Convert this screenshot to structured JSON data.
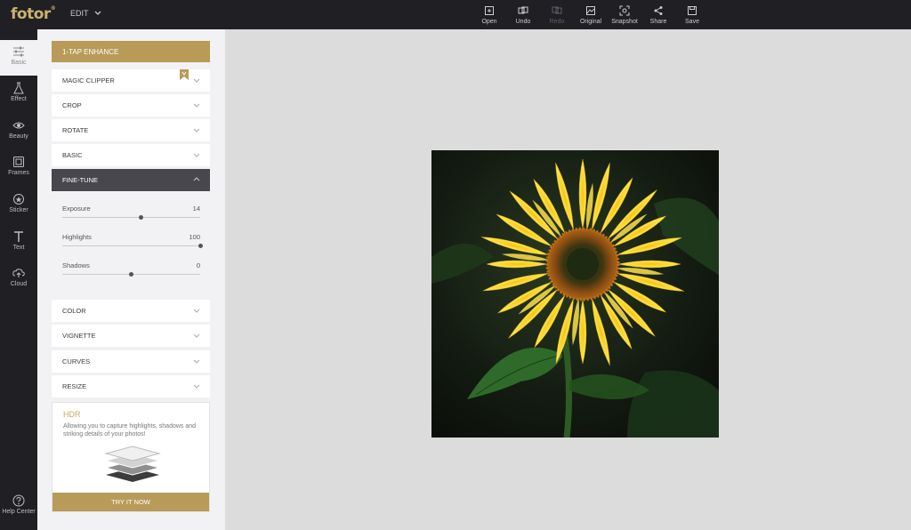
{
  "app": {
    "logo": "fotor",
    "logo_mark": "®",
    "edit_menu": "EDIT"
  },
  "toolbar": [
    {
      "label": "Open",
      "icon": "open-icon",
      "enabled": true
    },
    {
      "label": "Undo",
      "icon": "undo-icon",
      "enabled": true
    },
    {
      "label": "Redo",
      "icon": "redo-icon",
      "enabled": false
    },
    {
      "label": "Original",
      "icon": "original-icon",
      "enabled": true
    },
    {
      "label": "Snapshot",
      "icon": "snapshot-icon",
      "enabled": true
    },
    {
      "label": "Share",
      "icon": "share-icon",
      "enabled": true
    },
    {
      "label": "Save",
      "icon": "save-icon",
      "enabled": true
    }
  ],
  "rail": [
    {
      "label": "Basic",
      "icon": "sliders-icon",
      "active": true
    },
    {
      "label": "Effect",
      "icon": "flask-icon"
    },
    {
      "label": "Beauty",
      "icon": "eye-icon"
    },
    {
      "label": "Frames",
      "icon": "frame-icon"
    },
    {
      "label": "Sticker",
      "icon": "sticker-icon"
    },
    {
      "label": "Text",
      "icon": "text-icon"
    },
    {
      "label": "Cloud",
      "icon": "cloud-icon"
    }
  ],
  "help": {
    "label": "Help Center",
    "icon": "help-icon"
  },
  "panel": {
    "enhance_label": "1-TAP ENHANCE",
    "sections": [
      "MAGIC CLIPPER",
      "CROP",
      "ROTATE",
      "BASIC",
      "FINE-TUNE",
      "COLOR",
      "VIGNETTE",
      "CURVES",
      "RESIZE"
    ],
    "open_section": "FINE-TUNE",
    "finetune": [
      {
        "label": "Exposure",
        "value": "14",
        "fraction": 0.57
      },
      {
        "label": "Highlights",
        "value": "100",
        "fraction": 1.0
      },
      {
        "label": "Shadows",
        "value": "0",
        "fraction": 0.5
      }
    ],
    "hdr": {
      "title": "HDR",
      "description": "Allowing you to capture highlights, shadows and striking details of your photos!",
      "button": "TRY IT NOW"
    }
  },
  "colors": {
    "accent": "#b89b58",
    "dark": "#1f1f24",
    "open_section": "#48474d"
  }
}
